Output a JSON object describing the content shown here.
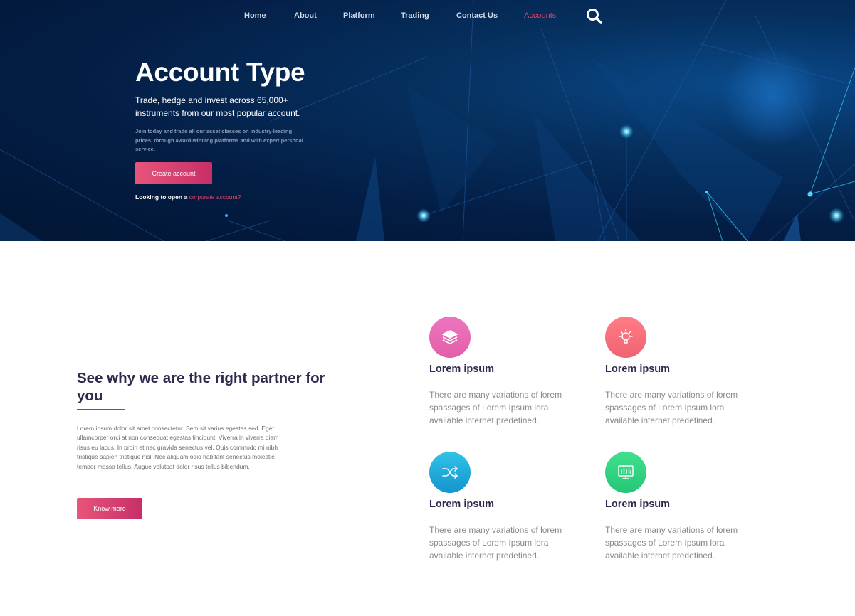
{
  "nav": {
    "items": [
      {
        "label": "Home"
      },
      {
        "label": "About"
      },
      {
        "label": "Platform"
      },
      {
        "label": "Trading"
      },
      {
        "label": "Contact Us"
      },
      {
        "label": "Accounts",
        "active": true
      }
    ],
    "search_icon": "search-icon"
  },
  "hero": {
    "title": "Account Type",
    "subtitle": "Trade, hedge and invest across 65,000+ instruments from our most popular account.",
    "small_text": "Join today and trade all our asset classes on industry-leading prices, through award-winning platforms and with expert personal service.",
    "cta_label": "Create account",
    "corporate_prefix": "Looking to open a",
    "corporate_link": "corporate account?"
  },
  "partner": {
    "title": "See why we are the right partner for you",
    "text": "Lorem ipsum dolor sit amet consectetur. Sem sit varius egestas sed. Eget ullamcorper orci at non consequat egestas tincidunt. Viverra in viverra diam risus eu lacus. In proin et nec gravida senectus vel. Quis commodo mi nibh tristique sapien tristique nisl. Nec aliquam odio habitant senectus molestie tempor massa tellus. Augue volutpat dolor risus tellus bibendum.",
    "button_label": "Know more"
  },
  "features": [
    {
      "icon": "layers-icon",
      "title": "Lorem ipsum",
      "text": "There are many variations of lorem spassages of Lorem Ipsum lora available internet predefined."
    },
    {
      "icon": "lightbulb-icon",
      "title": "Lorem ipsum",
      "text": "There are many variations of lorem spassages of Lorem Ipsum lora available internet predefined."
    },
    {
      "icon": "shuffle-icon",
      "title": "Lorem ipsum",
      "text": "There are many variations of lorem spassages of Lorem Ipsum lora available internet predefined."
    },
    {
      "icon": "chart-monitor-icon",
      "title": "Lorem ipsum",
      "text": "There are many variations of lorem spassages of Lorem Ipsum lora available internet predefined."
    }
  ],
  "colors": {
    "accent": "#e2456b",
    "hero_bg": "#031d44",
    "heading": "#2d2b4e",
    "underline": "#d9262e"
  }
}
